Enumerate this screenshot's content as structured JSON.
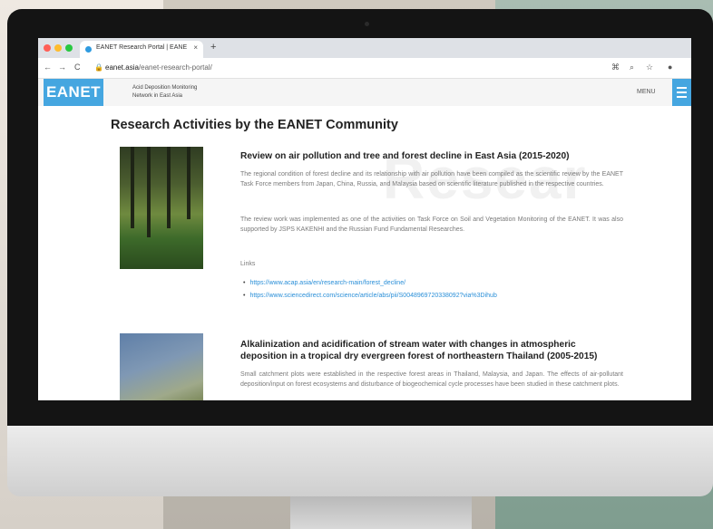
{
  "browser": {
    "tab_title": "EANET Research Portal | EANE",
    "tab_close": "×",
    "new_tab": "+",
    "url_domain": "eanet.asia",
    "url_path": "/eanet-research-portal/",
    "nav_back": "←",
    "nav_forward": "→",
    "nav_reload": "C",
    "lock": "🔒",
    "icons": [
      "⌘",
      "⌕",
      "☆",
      "●"
    ]
  },
  "site": {
    "logo": "EANET",
    "tagline_line1": "Acid Deposition Monitoring",
    "tagline_line2": "Network in East Asia",
    "menu_label": "MENU"
  },
  "page": {
    "title": "Research Activities by the EANET Community",
    "watermark": "Resear"
  },
  "articles": [
    {
      "title": "Review on air pollution and tree and forest decline in East Asia (2015-2020)",
      "paragraphs": [
        "The regional condition of forest decline and its relationship with air pollution have been compiled as the scientific review by the EANET Task Force members from Japan, China, Russia, and Malaysia based on scientific literature published in the respective countries.",
        "The review work was implemented as one of the activities on Task Force on Soil and Vegetation Monitoring of the EANET. It was also supported by JSPS KAKENHI and the Russian Fund Fundamental Researches."
      ],
      "links_label": "Links",
      "links": [
        "https://www.acap.asia/en/research-main/forest_decline/",
        "https://www.sciencedirect.com/science/article/abs/pii/S0048969720338092?via%3Dihub"
      ]
    },
    {
      "title_line1": "Alkalinization and acidification of stream water with changes in atmospheric",
      "title_line2": "deposition in a tropical dry evergreen forest of northeastern Thailand (2005-2015)",
      "paragraph": "Small catchment plots were established in the respective forest areas in Thailand, Malaysia, and Japan. The effects of air-pollutant deposition/input on forest ecosystems and disturbance of biogeochemical cycle processes have been studied in these catchment plots."
    }
  ],
  "colors": {
    "brand_blue": "#45a6e0",
    "link_blue": "#2a8fd8"
  }
}
